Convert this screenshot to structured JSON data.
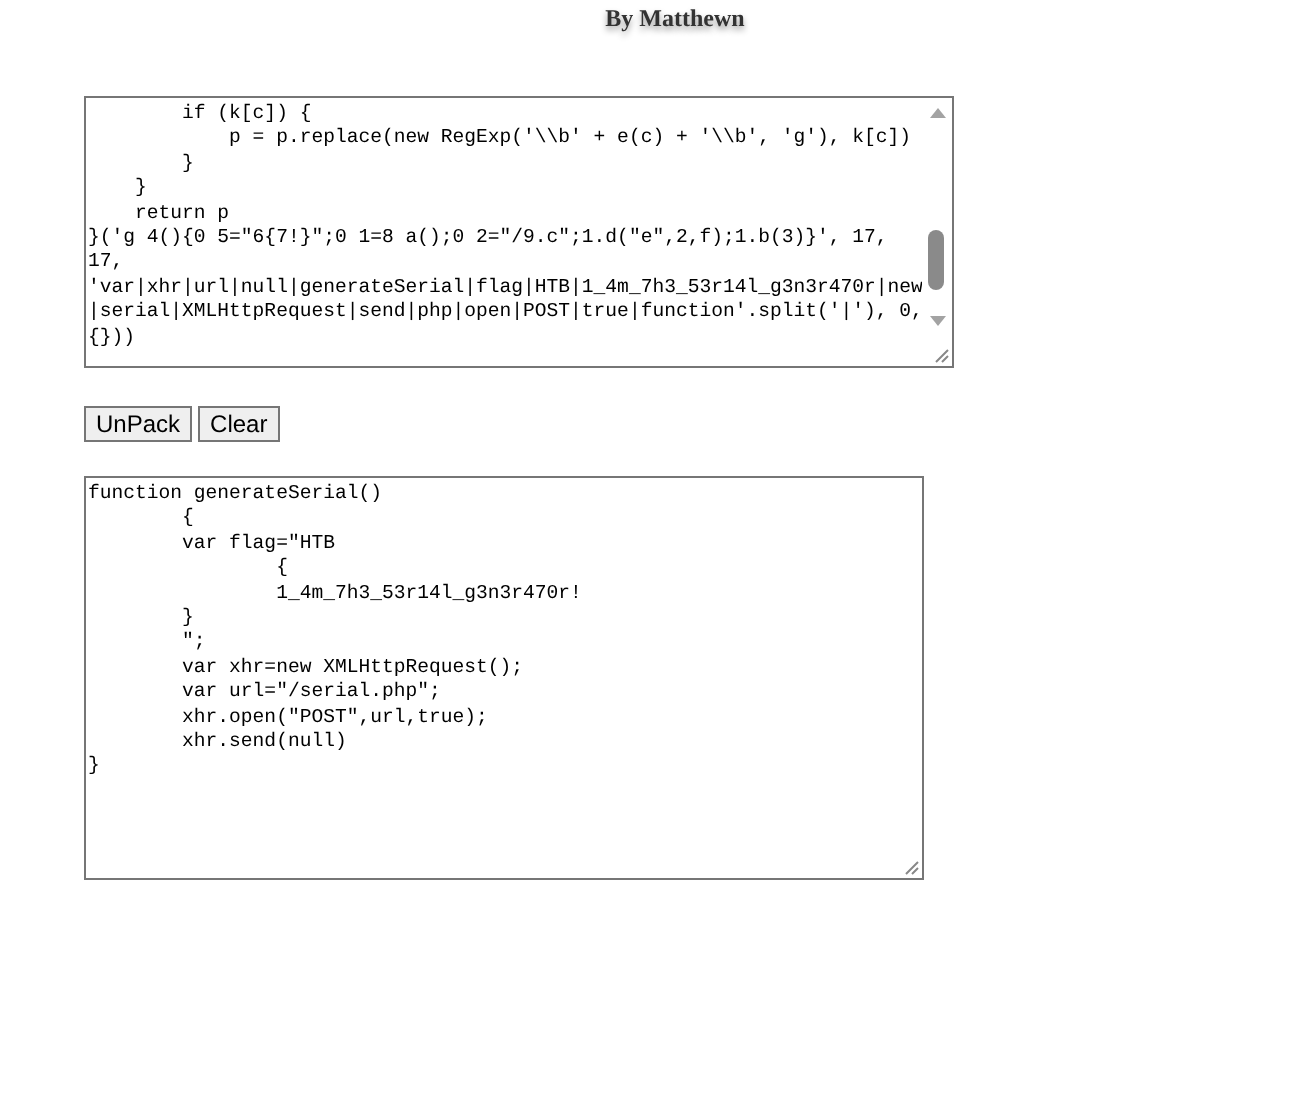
{
  "header": {
    "byline": "By Matthewn"
  },
  "packed_code": {
    "lines": [
      "        if (k[c]) {",
      "            p = p.replace(new RegExp('\\\\b' + e(c) + '\\\\b', 'g'), k[c])",
      "        }",
      "    }",
      "    return p",
      "}('g 4(){0 5=\"6{7!}\";0 1=8 a();0 2=\"/9.c\";1.d(\"e\",2,f);1.b(3)}', 17,",
      "17,",
      "'var|xhr|url|null|generateSerial|flag|HTB|1_4m_7h3_53r14l_g3n3r470r|new",
      "|serial|XMLHttpRequest|send|php|open|POST|true|function'.split('|'), 0,",
      "{}))"
    ]
  },
  "buttons": [
    {
      "label": "UnPack"
    },
    {
      "label": "Clear"
    }
  ],
  "unpacked_code": {
    "lines": [
      "function generateSerial()",
      "        {",
      "        var flag=\"HTB",
      "                {",
      "                1_4m_7h3_53r14l_g3n3r470r!",
      "        }",
      "        \";",
      "        var xhr=new XMLHttpRequest();",
      "        var url=\"/serial.php\";",
      "        xhr.open(\"POST\",url,true);",
      "        xhr.send(null)",
      "}"
    ]
  }
}
